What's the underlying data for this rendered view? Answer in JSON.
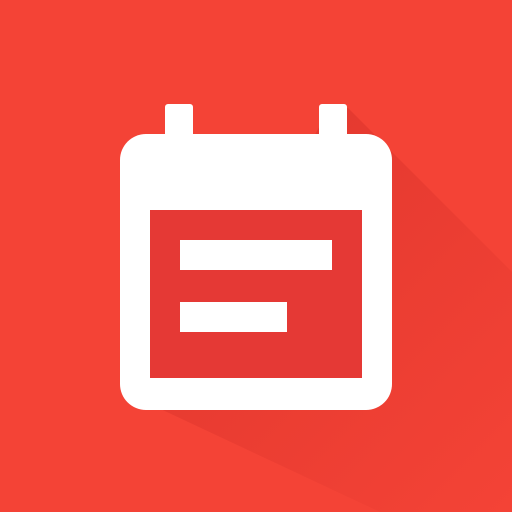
{
  "icon": {
    "name": "calendar-agenda-icon",
    "colors": {
      "background": "#F44336",
      "long_shadow": "#D32F2F",
      "glyph": "#FFFFFF"
    }
  }
}
